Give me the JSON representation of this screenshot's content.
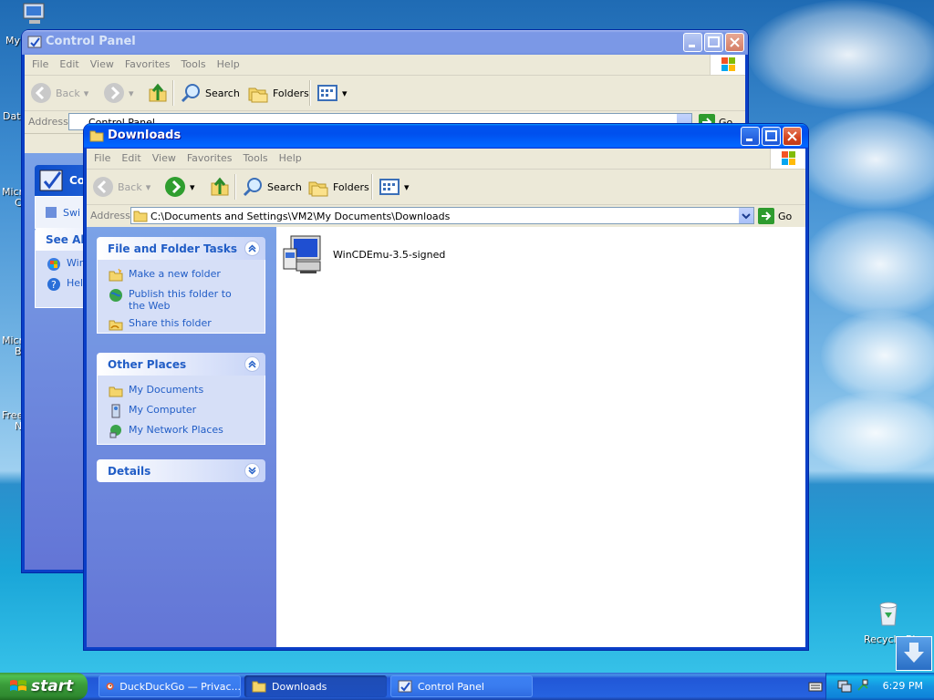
{
  "desktop": {
    "left_labels": [
      "My",
      "Dat",
      "Micro",
      "C",
      "Micro",
      "B",
      "Free",
      "N"
    ],
    "recycle_bin_label": "Recycle Bin"
  },
  "control_panel": {
    "title": "Control Panel",
    "menu": [
      "File",
      "Edit",
      "View",
      "Favorites",
      "Tools",
      "Help"
    ],
    "toolbar": {
      "back": "Back",
      "search": "Search",
      "folders": "Folders"
    },
    "address_label": "Address",
    "address_value": "Control Panel",
    "go_label": "Go",
    "side": {
      "header": "Control Panel",
      "switch_link": "Swi",
      "see_also_header": "See Als",
      "see_also_items": [
        "Win",
        "Hel"
      ]
    }
  },
  "downloads": {
    "title": "Downloads",
    "menu": [
      "File",
      "Edit",
      "View",
      "Favorites",
      "Tools",
      "Help"
    ],
    "toolbar": {
      "back": "Back",
      "search": "Search",
      "folders": "Folders"
    },
    "address_label": "Address",
    "address_value": "C:\\Documents and Settings\\VM2\\My Documents\\Downloads",
    "go_label": "Go",
    "panels": {
      "file_tasks": {
        "title": "File and Folder Tasks",
        "items": [
          "Make a new folder",
          "Publish this folder to the Web",
          "Share this folder"
        ]
      },
      "other_places": {
        "title": "Other Places",
        "items": [
          "My Documents",
          "My Computer",
          "My Network Places"
        ]
      },
      "details": {
        "title": "Details"
      }
    },
    "files": [
      {
        "name": "WinCDEmu-3.5-signed",
        "icon": "installer-icon"
      }
    ]
  },
  "taskbar": {
    "start_label": "start",
    "buttons": [
      {
        "label": "DuckDuckGo — Privac...",
        "icon": "browser-icon"
      },
      {
        "label": "Downloads",
        "icon": "folder-icon"
      },
      {
        "label": "Control Panel",
        "icon": "control-panel-icon"
      }
    ],
    "clock": "6:29 PM"
  }
}
